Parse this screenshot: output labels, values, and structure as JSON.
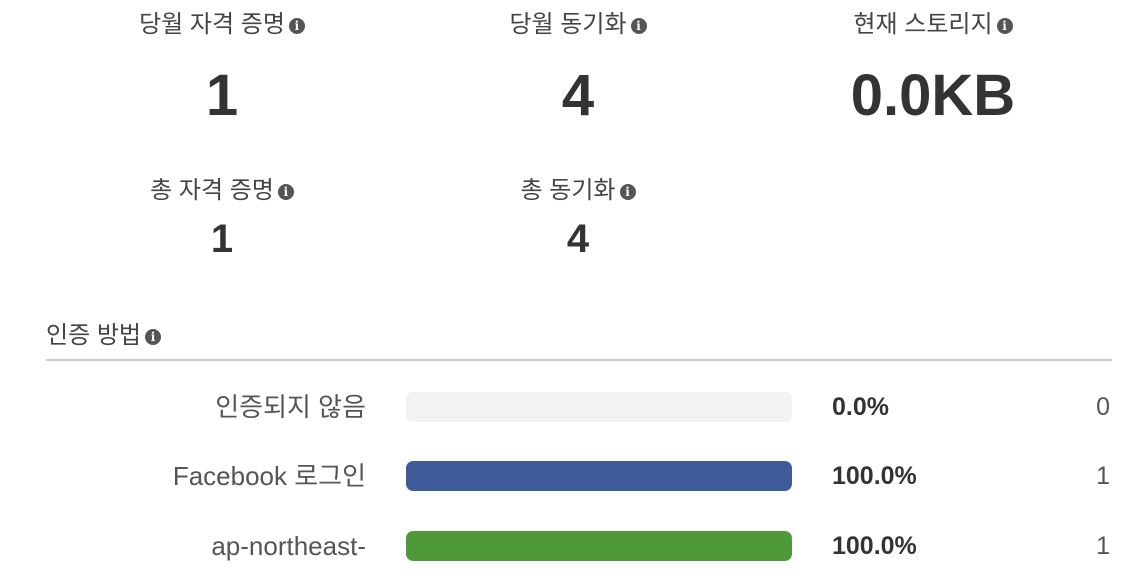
{
  "stats": {
    "monthly_credentials": {
      "label": "당월 자격 증명",
      "value": "1"
    },
    "monthly_syncs": {
      "label": "당월 동기화",
      "value": "4"
    },
    "current_storage": {
      "label": "현재 스토리지",
      "value": "0.0KB"
    },
    "total_credentials": {
      "label": "총 자격 증명",
      "value": "1"
    },
    "total_syncs": {
      "label": "총 동기화",
      "value": "4"
    }
  },
  "auth": {
    "title": "인증 방법",
    "rows": [
      {
        "label": "인증되지 않음",
        "percent": "0.0%",
        "count": "0",
        "fraction": 0.0,
        "color": "#3d5a99"
      },
      {
        "label": "Facebook 로그인",
        "percent": "100.0%",
        "count": "1",
        "fraction": 1.0,
        "color": "#3d5a99"
      },
      {
        "label": "ap-northeast-",
        "percent": "100.0%",
        "count": "1",
        "fraction": 1.0,
        "color": "#4e9a3a"
      }
    ]
  },
  "icons": {
    "info": "info-icon"
  }
}
